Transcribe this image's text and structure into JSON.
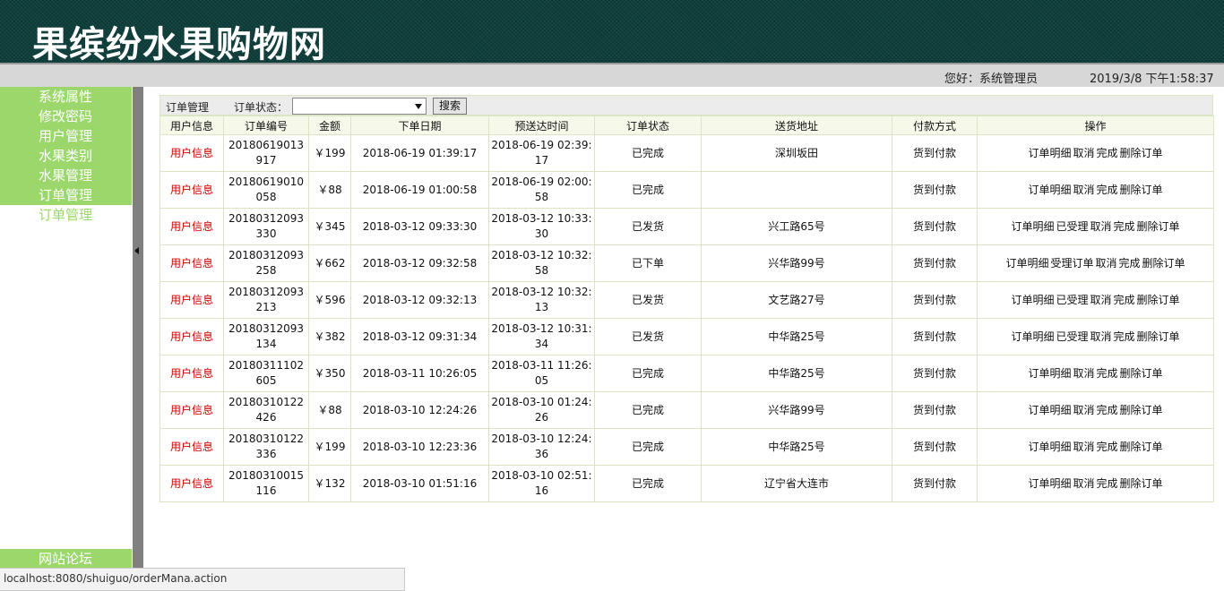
{
  "header": {
    "title": "果缤纷水果购物网"
  },
  "info_bar": {
    "greeting": "您好：系统管理员",
    "datetime": "2019/3/8 下午1:58:37"
  },
  "sidebar": {
    "items": [
      {
        "label": "系统属性"
      },
      {
        "label": "修改密码"
      },
      {
        "label": "用户管理"
      },
      {
        "label": "水果类别"
      },
      {
        "label": "水果管理"
      },
      {
        "label": "订单管理"
      }
    ],
    "sub_item": "订单管理",
    "forum": "网站论坛"
  },
  "toolbar": {
    "title": "订单管理",
    "status_label": "订单状态：",
    "status_value": "",
    "search_label": "搜索"
  },
  "table": {
    "headers": [
      "用户信息",
      "订单编号",
      "金额",
      "下单日期",
      "预送达时间",
      "订单状态",
      "送货地址",
      "付款方式",
      "操作"
    ],
    "rows": [
      {
        "user": "用户信息",
        "order_no": "20180619013917",
        "amount": "￥199",
        "order_date": "2018-06-19 01:39:17",
        "delivery": "2018-06-19 02:39:17",
        "status": "已完成",
        "address": "深圳坂田",
        "payment": "货到付款",
        "ops": [
          "订单明细",
          "取消",
          "完成",
          "删除订单"
        ]
      },
      {
        "user": "用户信息",
        "order_no": "20180619010058",
        "amount": "￥88",
        "order_date": "2018-06-19 01:00:58",
        "delivery": "2018-06-19 02:00:58",
        "status": "已完成",
        "address": "",
        "payment": "货到付款",
        "ops": [
          "订单明细",
          "取消",
          "完成",
          "删除订单"
        ]
      },
      {
        "user": "用户信息",
        "order_no": "20180312093330",
        "amount": "￥345",
        "order_date": "2018-03-12 09:33:30",
        "delivery": "2018-03-12 10:33:30",
        "status": "已发货",
        "address": "兴工路65号",
        "payment": "货到付款",
        "ops": [
          "订单明细",
          "已受理",
          "取消",
          "完成",
          "删除订单"
        ]
      },
      {
        "user": "用户信息",
        "order_no": "20180312093258",
        "amount": "￥662",
        "order_date": "2018-03-12 09:32:58",
        "delivery": "2018-03-12 10:32:58",
        "status": "已下单",
        "address": "兴华路99号",
        "payment": "货到付款",
        "ops": [
          "订单明细",
          "受理订单",
          "取消",
          "完成",
          "删除订单"
        ]
      },
      {
        "user": "用户信息",
        "order_no": "20180312093213",
        "amount": "￥596",
        "order_date": "2018-03-12 09:32:13",
        "delivery": "2018-03-12 10:32:13",
        "status": "已发货",
        "address": "文艺路27号",
        "payment": "货到付款",
        "ops": [
          "订单明细",
          "已受理",
          "取消",
          "完成",
          "删除订单"
        ]
      },
      {
        "user": "用户信息",
        "order_no": "20180312093134",
        "amount": "￥382",
        "order_date": "2018-03-12 09:31:34",
        "delivery": "2018-03-12 10:31:34",
        "status": "已发货",
        "address": "中华路25号",
        "payment": "货到付款",
        "ops": [
          "订单明细",
          "已受理",
          "取消",
          "完成",
          "删除订单"
        ]
      },
      {
        "user": "用户信息",
        "order_no": "20180311102605",
        "amount": "￥350",
        "order_date": "2018-03-11 10:26:05",
        "delivery": "2018-03-11 11:26:05",
        "status": "已完成",
        "address": "中华路25号",
        "payment": "货到付款",
        "ops": [
          "订单明细",
          "取消",
          "完成",
          "删除订单"
        ]
      },
      {
        "user": "用户信息",
        "order_no": "20180310122426",
        "amount": "￥88",
        "order_date": "2018-03-10 12:24:26",
        "delivery": "2018-03-10 01:24:26",
        "status": "已完成",
        "address": "兴华路99号",
        "payment": "货到付款",
        "ops": [
          "订单明细",
          "取消",
          "完成",
          "删除订单"
        ]
      },
      {
        "user": "用户信息",
        "order_no": "20180310122336",
        "amount": "￥199",
        "order_date": "2018-03-10 12:23:36",
        "delivery": "2018-03-10 12:24:36",
        "status": "已完成",
        "address": "中华路25号",
        "payment": "货到付款",
        "ops": [
          "订单明细",
          "取消",
          "完成",
          "删除订单"
        ]
      },
      {
        "user": "用户信息",
        "order_no": "20180310015116",
        "amount": "￥132",
        "order_date": "2018-03-10 01:51:16",
        "delivery": "2018-03-10 02:51:16",
        "status": "已完成",
        "address": "辽宁省大连市",
        "payment": "货到付款",
        "ops": [
          "订单明细",
          "取消",
          "完成",
          "删除订单"
        ]
      }
    ]
  },
  "statusbar": {
    "url": "localhost:8080/shuiguo/orderMana.action"
  },
  "colors": {
    "header_bg": "#0f3f3c",
    "menu_green": "#9bd76b",
    "user_link": "#cc0000",
    "grid_border": "#d9e5c4"
  }
}
